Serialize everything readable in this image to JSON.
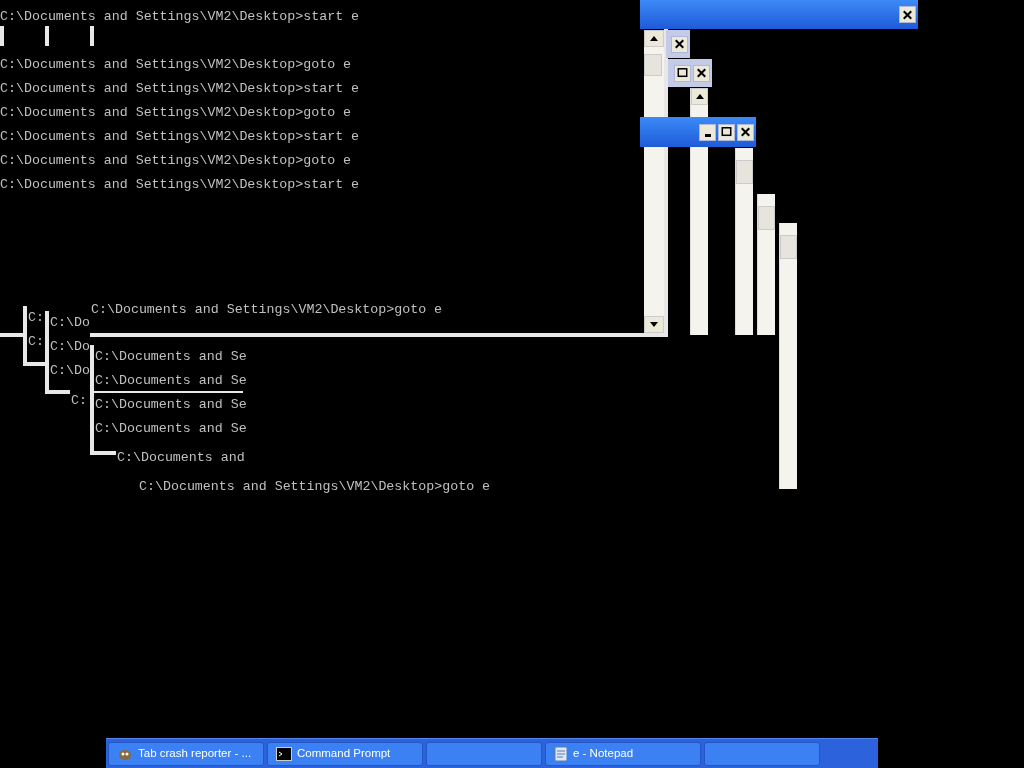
{
  "main_console": {
    "lines": [
      "C:\\Documents and Settings\\VM2\\Desktop>start e",
      "C:\\Documents and Settings\\VM2\\Desktop>goto e",
      "C:\\Documents and Settings\\VM2\\Desktop>start e",
      "C:\\Documents and Settings\\VM2\\Desktop>goto e",
      "C:\\Documents and Settings\\VM2\\Desktop>start e",
      "C:\\Documents and Settings\\VM2\\Desktop>goto e",
      "C:\\Documents and Settings\\VM2\\Desktop>start e"
    ]
  },
  "window_fragments": [
    {
      "kind": "titlebar"
    },
    {
      "kind": "frame"
    },
    {
      "kind": "frame"
    },
    {
      "kind": "titlebar"
    }
  ],
  "console_fragments": [
    {
      "lines": [
        "C:",
        "C:"
      ]
    },
    {
      "lines": [
        "C:\\Do",
        "C:\\Do",
        "C:\\Do"
      ]
    },
    {
      "lines": [
        "C:"
      ]
    },
    {
      "lines": [
        "C:\\Documents and Settings\\VM2\\Desktop>goto e"
      ]
    },
    {
      "lines": [
        "C:\\Documents and Se",
        "C:\\Documents and Se"
      ]
    },
    {
      "lines": [
        "C:\\Documents and Se",
        "C:\\Documents and Se"
      ]
    },
    {
      "lines": [
        "C:\\Documents and"
      ]
    },
    {
      "lines": [
        "C:\\Documents and Settings\\VM2\\Desktop>goto e"
      ]
    }
  ],
  "taskbar": {
    "buttons": [
      {
        "label": "Tab crash reporter - ...",
        "kind": "crash"
      },
      {
        "label": "Command Prompt",
        "kind": "console"
      },
      {
        "kind": "empty"
      },
      {
        "label": "e - Notepad",
        "kind": "notepad"
      },
      {
        "kind": "empty"
      }
    ]
  }
}
